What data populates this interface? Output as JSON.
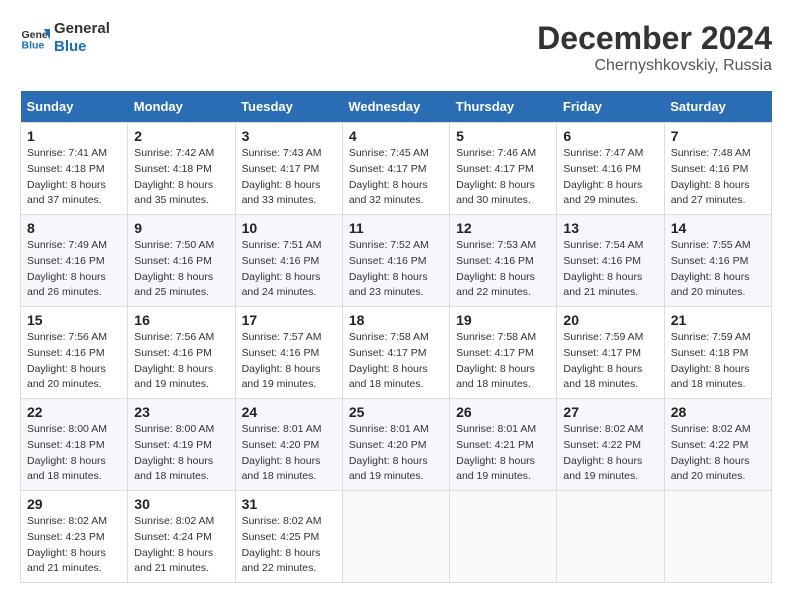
{
  "logo": {
    "line1": "General",
    "line2": "Blue"
  },
  "title": "December 2024",
  "subtitle": "Chernyshkovskiy, Russia",
  "days_header": [
    "Sunday",
    "Monday",
    "Tuesday",
    "Wednesday",
    "Thursday",
    "Friday",
    "Saturday"
  ],
  "weeks": [
    [
      {
        "day": "1",
        "sunrise": "7:41 AM",
        "sunset": "4:18 PM",
        "daylight": "8 hours and 37 minutes."
      },
      {
        "day": "2",
        "sunrise": "7:42 AM",
        "sunset": "4:18 PM",
        "daylight": "8 hours and 35 minutes."
      },
      {
        "day": "3",
        "sunrise": "7:43 AM",
        "sunset": "4:17 PM",
        "daylight": "8 hours and 33 minutes."
      },
      {
        "day": "4",
        "sunrise": "7:45 AM",
        "sunset": "4:17 PM",
        "daylight": "8 hours and 32 minutes."
      },
      {
        "day": "5",
        "sunrise": "7:46 AM",
        "sunset": "4:17 PM",
        "daylight": "8 hours and 30 minutes."
      },
      {
        "day": "6",
        "sunrise": "7:47 AM",
        "sunset": "4:16 PM",
        "daylight": "8 hours and 29 minutes."
      },
      {
        "day": "7",
        "sunrise": "7:48 AM",
        "sunset": "4:16 PM",
        "daylight": "8 hours and 27 minutes."
      }
    ],
    [
      {
        "day": "8",
        "sunrise": "7:49 AM",
        "sunset": "4:16 PM",
        "daylight": "8 hours and 26 minutes."
      },
      {
        "day": "9",
        "sunrise": "7:50 AM",
        "sunset": "4:16 PM",
        "daylight": "8 hours and 25 minutes."
      },
      {
        "day": "10",
        "sunrise": "7:51 AM",
        "sunset": "4:16 PM",
        "daylight": "8 hours and 24 minutes."
      },
      {
        "day": "11",
        "sunrise": "7:52 AM",
        "sunset": "4:16 PM",
        "daylight": "8 hours and 23 minutes."
      },
      {
        "day": "12",
        "sunrise": "7:53 AM",
        "sunset": "4:16 PM",
        "daylight": "8 hours and 22 minutes."
      },
      {
        "day": "13",
        "sunrise": "7:54 AM",
        "sunset": "4:16 PM",
        "daylight": "8 hours and 21 minutes."
      },
      {
        "day": "14",
        "sunrise": "7:55 AM",
        "sunset": "4:16 PM",
        "daylight": "8 hours and 20 minutes."
      }
    ],
    [
      {
        "day": "15",
        "sunrise": "7:56 AM",
        "sunset": "4:16 PM",
        "daylight": "8 hours and 20 minutes."
      },
      {
        "day": "16",
        "sunrise": "7:56 AM",
        "sunset": "4:16 PM",
        "daylight": "8 hours and 19 minutes."
      },
      {
        "day": "17",
        "sunrise": "7:57 AM",
        "sunset": "4:16 PM",
        "daylight": "8 hours and 19 minutes."
      },
      {
        "day": "18",
        "sunrise": "7:58 AM",
        "sunset": "4:17 PM",
        "daylight": "8 hours and 18 minutes."
      },
      {
        "day": "19",
        "sunrise": "7:58 AM",
        "sunset": "4:17 PM",
        "daylight": "8 hours and 18 minutes."
      },
      {
        "day": "20",
        "sunrise": "7:59 AM",
        "sunset": "4:17 PM",
        "daylight": "8 hours and 18 minutes."
      },
      {
        "day": "21",
        "sunrise": "7:59 AM",
        "sunset": "4:18 PM",
        "daylight": "8 hours and 18 minutes."
      }
    ],
    [
      {
        "day": "22",
        "sunrise": "8:00 AM",
        "sunset": "4:18 PM",
        "daylight": "8 hours and 18 minutes."
      },
      {
        "day": "23",
        "sunrise": "8:00 AM",
        "sunset": "4:19 PM",
        "daylight": "8 hours and 18 minutes."
      },
      {
        "day": "24",
        "sunrise": "8:01 AM",
        "sunset": "4:20 PM",
        "daylight": "8 hours and 18 minutes."
      },
      {
        "day": "25",
        "sunrise": "8:01 AM",
        "sunset": "4:20 PM",
        "daylight": "8 hours and 19 minutes."
      },
      {
        "day": "26",
        "sunrise": "8:01 AM",
        "sunset": "4:21 PM",
        "daylight": "8 hours and 19 minutes."
      },
      {
        "day": "27",
        "sunrise": "8:02 AM",
        "sunset": "4:22 PM",
        "daylight": "8 hours and 19 minutes."
      },
      {
        "day": "28",
        "sunrise": "8:02 AM",
        "sunset": "4:22 PM",
        "daylight": "8 hours and 20 minutes."
      }
    ],
    [
      {
        "day": "29",
        "sunrise": "8:02 AM",
        "sunset": "4:23 PM",
        "daylight": "8 hours and 21 minutes."
      },
      {
        "day": "30",
        "sunrise": "8:02 AM",
        "sunset": "4:24 PM",
        "daylight": "8 hours and 21 minutes."
      },
      {
        "day": "31",
        "sunrise": "8:02 AM",
        "sunset": "4:25 PM",
        "daylight": "8 hours and 22 minutes."
      },
      null,
      null,
      null,
      null
    ]
  ],
  "labels": {
    "sunrise": "Sunrise:",
    "sunset": "Sunset:",
    "daylight": "Daylight:"
  }
}
